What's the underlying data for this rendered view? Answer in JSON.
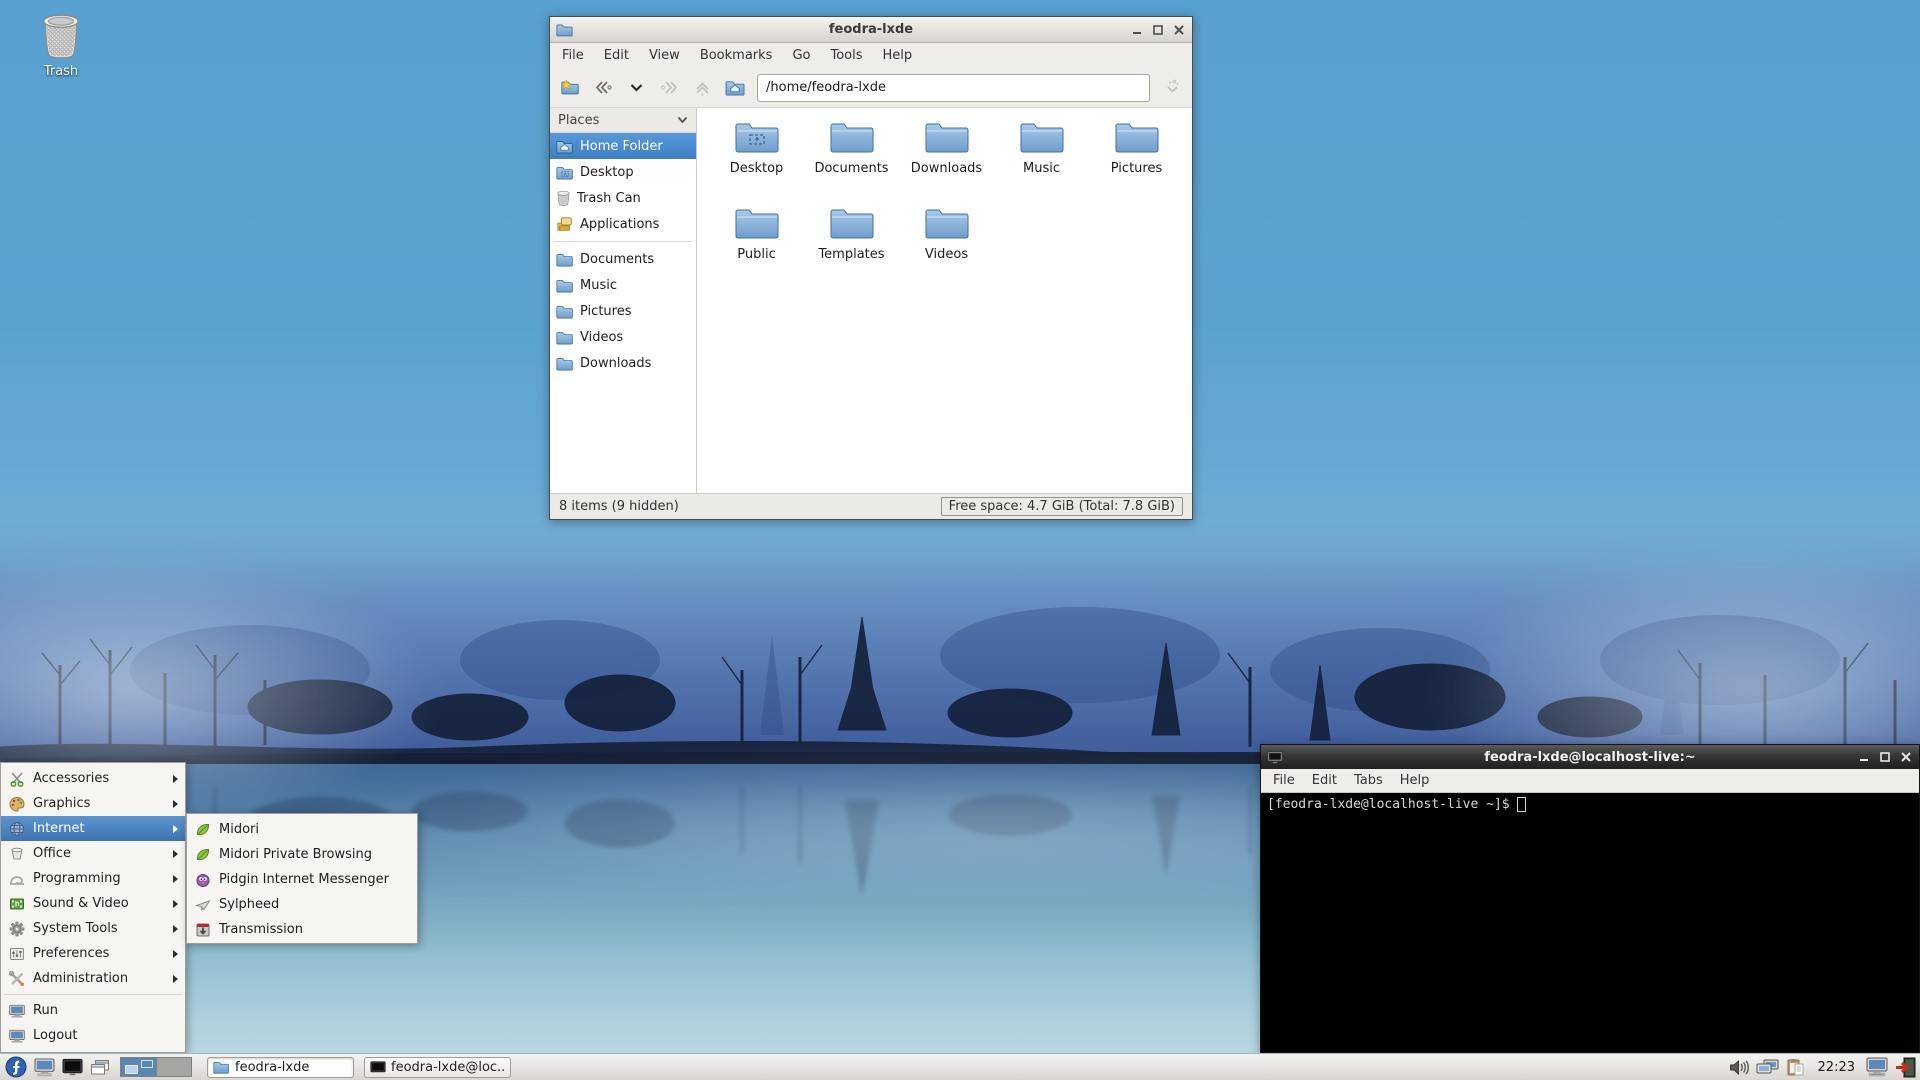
{
  "desktop": {
    "trash_label": "Trash"
  },
  "file_manager": {
    "title": "feodra-lxde",
    "menu": [
      "File",
      "Edit",
      "View",
      "Bookmarks",
      "Go",
      "Tools",
      "Help"
    ],
    "path": "/home/feodra-lxde",
    "places_header": "Places",
    "places": [
      {
        "label": "Home Folder",
        "icon": "home-folder",
        "selected": true
      },
      {
        "label": "Desktop",
        "icon": "desktop-folder"
      },
      {
        "label": "Trash Can",
        "icon": "trash-can"
      },
      {
        "label": "Applications",
        "icon": "applications"
      },
      {
        "label": "Documents",
        "icon": "folder"
      },
      {
        "label": "Music",
        "icon": "folder"
      },
      {
        "label": "Pictures",
        "icon": "folder"
      },
      {
        "label": "Videos",
        "icon": "folder"
      },
      {
        "label": "Downloads",
        "icon": "folder"
      }
    ],
    "folders": [
      "Desktop",
      "Documents",
      "Downloads",
      "Music",
      "Pictures",
      "Public",
      "Templates",
      "Videos"
    ],
    "status_left": "8 items (9 hidden)",
    "status_right": "Free space: 4.7 GiB (Total: 7.8 GiB)"
  },
  "terminal": {
    "title": "feodra-lxde@localhost-live:~",
    "menu": [
      "File",
      "Edit",
      "Tabs",
      "Help"
    ],
    "prompt": "[feodra-lxde@localhost-live ~]$"
  },
  "app_menu": {
    "items": [
      {
        "label": "Accessories",
        "icon": "scissors",
        "submenu": true
      },
      {
        "label": "Graphics",
        "icon": "palette",
        "submenu": true
      },
      {
        "label": "Internet",
        "icon": "globe",
        "submenu": true,
        "selected": true
      },
      {
        "label": "Office",
        "icon": "office",
        "submenu": true
      },
      {
        "label": "Programming",
        "icon": "programming",
        "submenu": true
      },
      {
        "label": "Sound & Video",
        "icon": "film",
        "submenu": true
      },
      {
        "label": "System Tools",
        "icon": "gear",
        "submenu": true
      },
      {
        "label": "Preferences",
        "icon": "sliders",
        "submenu": true
      },
      {
        "label": "Administration",
        "icon": "tools",
        "submenu": true
      },
      {
        "label": "Run",
        "icon": "monitor",
        "submenu": false
      },
      {
        "label": "Logout",
        "icon": "monitor",
        "submenu": false
      }
    ],
    "submenu": [
      "Midori",
      "Midori Private Browsing",
      "Pidgin Internet Messenger",
      "Sylpheed",
      "Transmission"
    ]
  },
  "taskbar": {
    "tasks": [
      "feodra-lxde",
      "feodra-lxde@loc..."
    ],
    "clock": "22:23"
  },
  "colors": {
    "selection_blue": "#4a8fd4",
    "menu_highlight": "#4f86c6",
    "folder_blue": "#7ba3cd",
    "taskbar_bg": "#e7e5e1",
    "terminal_bg": "#000000",
    "terminal_fg": "#d8d8d8"
  }
}
